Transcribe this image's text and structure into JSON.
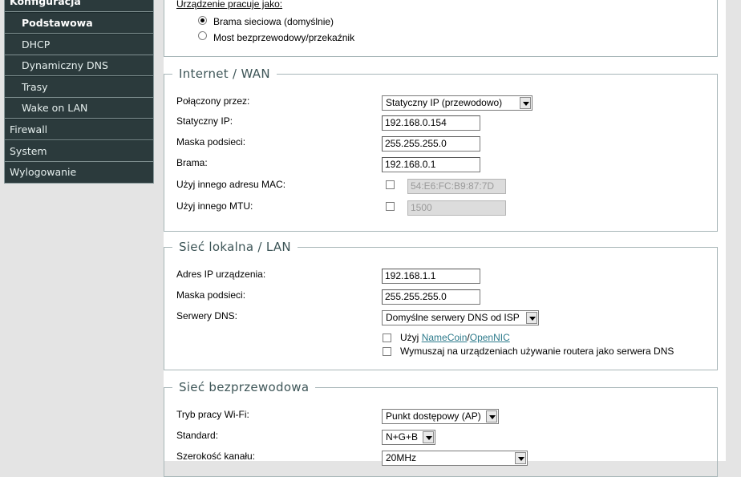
{
  "sidebar": {
    "section_header": "Konfiguracja",
    "items": [
      {
        "label": "Podstawowa",
        "level": "sub",
        "active": true
      },
      {
        "label": "DHCP",
        "level": "sub",
        "active": false
      },
      {
        "label": "Dynamiczny DNS",
        "level": "sub",
        "active": false
      },
      {
        "label": "Trasy",
        "level": "sub",
        "active": false
      },
      {
        "label": "Wake on LAN",
        "level": "sub",
        "active": false
      },
      {
        "label": "Firewall",
        "level": "main",
        "active": false
      },
      {
        "label": "System",
        "level": "main",
        "active": false
      },
      {
        "label": "Wylogowanie",
        "level": "main",
        "active": false
      }
    ]
  },
  "mode": {
    "label": "Urządzenie pracuje jako:",
    "options": [
      {
        "label": "Brama sieciowa (domyślnie)",
        "selected": true
      },
      {
        "label": "Most bezprzewodowy/przekaźnik",
        "selected": false
      }
    ]
  },
  "wan": {
    "title": "Internet / WAN",
    "connected_via_label": "Połączony przez:",
    "connected_via_value": "Statyczny IP (przewodowo)",
    "static_ip_label": "Statyczny IP:",
    "static_ip_value": "192.168.0.154",
    "subnet_label": "Maska podsieci:",
    "subnet_value": "255.255.255.0",
    "gateway_label": "Brama:",
    "gateway_value": "192.168.0.1",
    "mac_label": "Użyj innego adresu MAC:",
    "mac_value": "54:E6:FC:B9:87:7D",
    "mtu_label": "Użyj innego MTU:",
    "mtu_value": "1500"
  },
  "lan": {
    "title": "Sieć lokalna / LAN",
    "ip_label": "Adres IP urządzenia:",
    "ip_value": "192.168.1.1",
    "subnet_label": "Maska podsieci:",
    "subnet_value": "255.255.255.0",
    "dns_label": "Serwery DNS:",
    "dns_value": "Domyślne serwery DNS od ISP",
    "use_prefix": "Użyj",
    "namecoin_link": "NameCoin",
    "slash": "/",
    "opennic_link": "OpenNIC",
    "force_dns_label": "Wymuszaj na urządzeniach używanie routera jako serwera DNS"
  },
  "wifi": {
    "title": "Sieć bezprzewodowa",
    "mode_label": "Tryb pracy Wi-Fi:",
    "mode_value": "Punkt dostępowy (AP)",
    "standard_label": "Standard:",
    "standard_value": "N+G+B",
    "width_label": "Szerokość kanału:",
    "width_value": "20MHz"
  },
  "colors": {
    "sidebar_bg": "#2b3a3c",
    "legend_text": "#3d5557",
    "link": "#2e7b8c"
  }
}
